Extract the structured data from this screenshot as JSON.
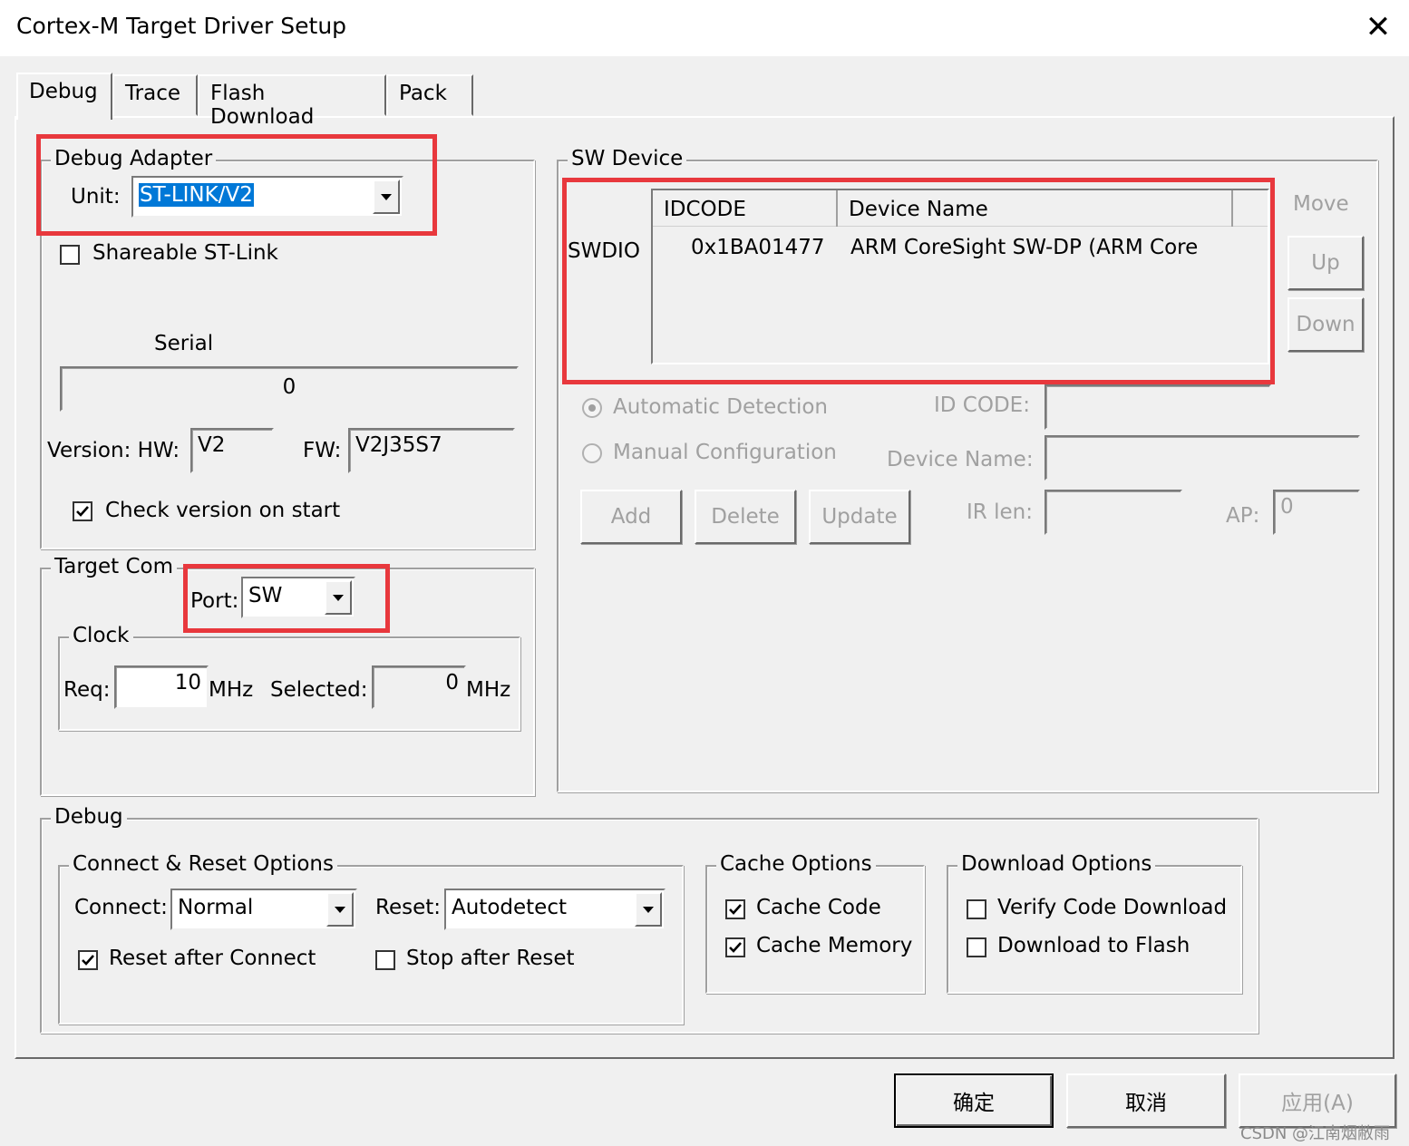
{
  "window": {
    "title": "Cortex-M Target Driver Setup"
  },
  "tabs": [
    {
      "label": "Debug"
    },
    {
      "label": "Trace"
    },
    {
      "label": "Flash Download"
    },
    {
      "label": "Pack"
    }
  ],
  "debug_adapter": {
    "legend": "Debug Adapter",
    "unit_label": "Unit:",
    "unit_value": "ST-LINK/V2",
    "shareable_label": "Shareable ST-Link",
    "serial_label": "Serial",
    "serial_value": "0",
    "version_hw_label": "Version: HW:",
    "hw_value": "V2",
    "fw_label": "FW:",
    "fw_value": "V2J35S7",
    "check_version_label": "Check version on start"
  },
  "target_com": {
    "legend": "Target Com",
    "port_label": "Port:",
    "port_value": "SW",
    "clock_legend": "Clock",
    "req_label": "Req:",
    "req_value": "10",
    "req_unit": "MHz",
    "selected_label": "Selected:",
    "selected_value": "0",
    "selected_unit": "MHz"
  },
  "sw_device": {
    "legend": "SW Device",
    "row_label": "SWDIO",
    "columns": [
      "IDCODE",
      "Device Name"
    ],
    "rows": [
      {
        "idcode": "0x1BA01477",
        "device_name": "ARM CoreSight SW-DP (ARM Core"
      }
    ],
    "move_label": "Move",
    "up_label": "Up",
    "down_label": "Down",
    "auto_detect_label": "Automatic Detection",
    "manual_config_label": "Manual Configuration",
    "id_code_label": "ID CODE:",
    "device_name_label": "Device Name:",
    "add_label": "Add",
    "delete_label": "Delete",
    "update_label": "Update",
    "ir_len_label": "IR len:",
    "ap_label": "AP:",
    "ap_value": "0"
  },
  "debug_section": {
    "legend": "Debug",
    "connect_reset": {
      "legend": "Connect & Reset Options",
      "connect_label": "Connect:",
      "connect_value": "Normal",
      "reset_label": "Reset:",
      "reset_value": "Autodetect",
      "reset_after_connect": "Reset after Connect",
      "stop_after_reset": "Stop after Reset"
    },
    "cache": {
      "legend": "Cache Options",
      "cache_code": "Cache Code",
      "cache_memory": "Cache Memory"
    },
    "download": {
      "legend": "Download Options",
      "verify_code": "Verify Code Download",
      "download_flash": "Download to Flash"
    }
  },
  "footer": {
    "ok_label": "确定",
    "cancel_label": "取消",
    "apply_label": "应用(A)"
  },
  "watermark": "CSDN @江南烟敝雨",
  "colors": {
    "highlight_red": "#e8383d",
    "selection_blue": "#0078d7"
  }
}
